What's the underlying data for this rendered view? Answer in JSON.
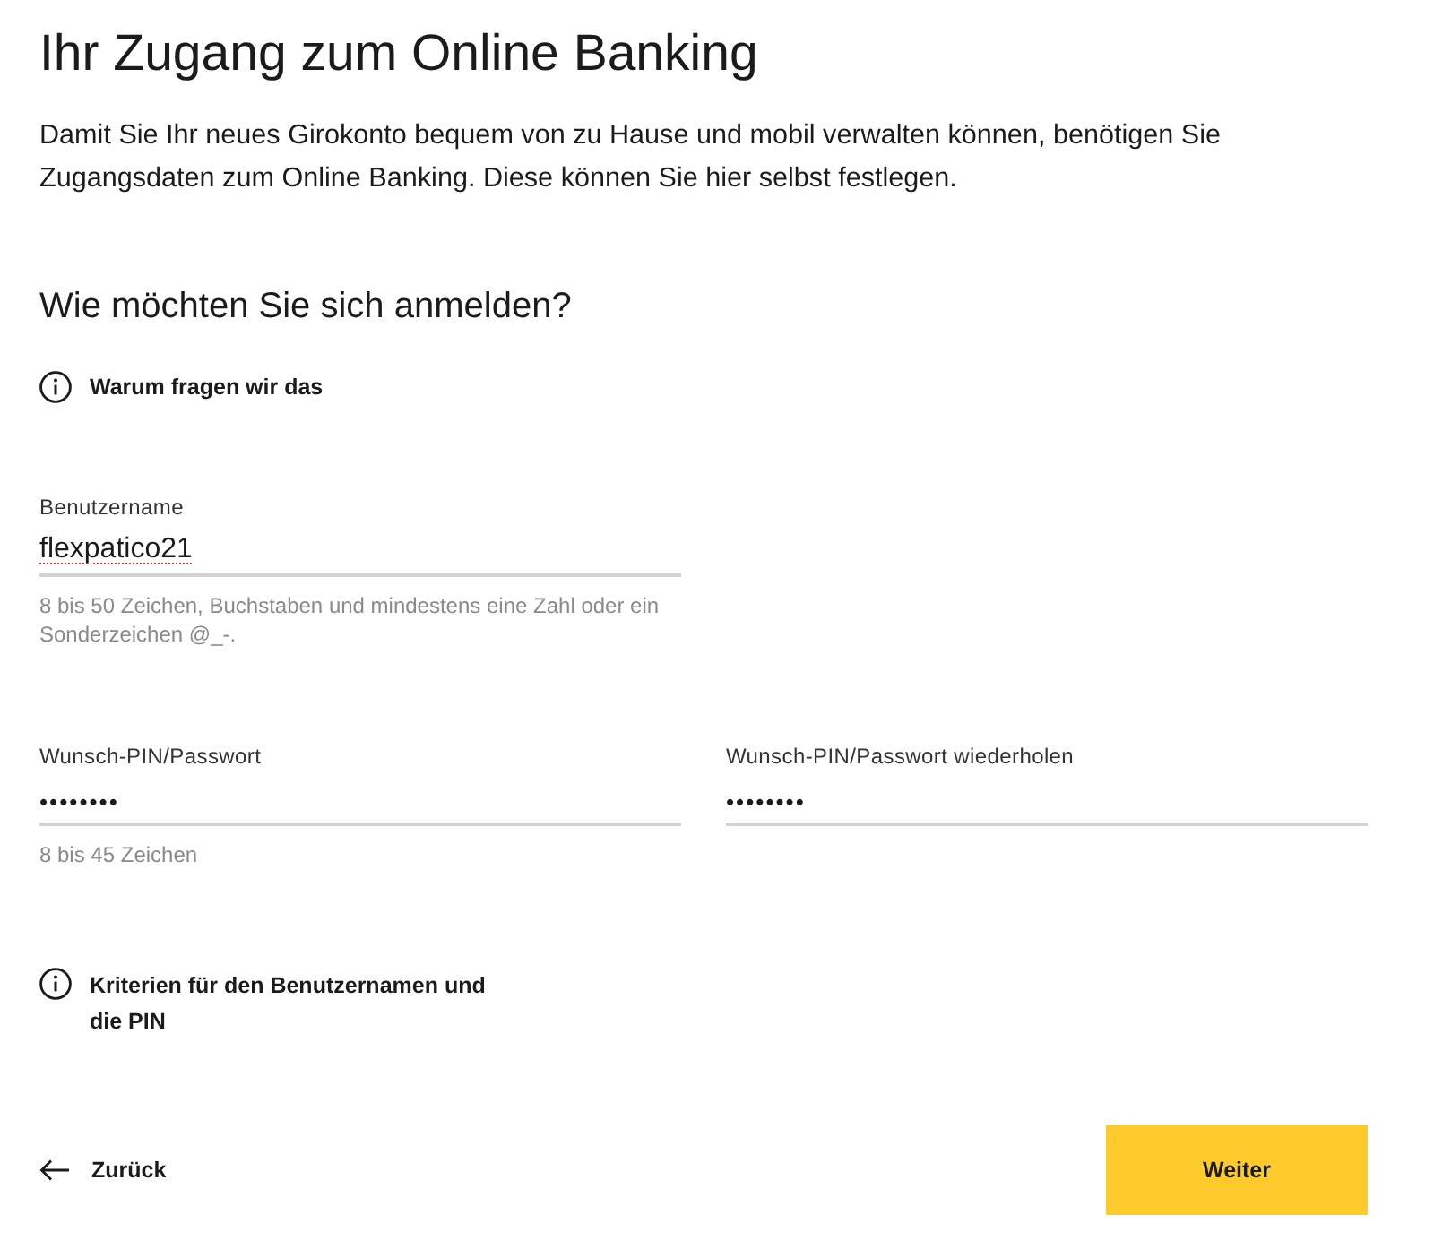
{
  "page": {
    "title": "Ihr Zugang zum Online Banking",
    "intro": "Damit Sie Ihr neues Girokonto bequem von zu Hause und mobil verwalten können, benötigen Sie Zugangsdaten zum Online Banking. Diese können Sie hier selbst festlegen."
  },
  "login": {
    "heading": "Wie möchten Sie sich anmelden?",
    "info_link": "Warum fragen wir das"
  },
  "rows": [
    {
      "fields": [
        {
          "kind": "text",
          "label": "Benutzername",
          "value": "flexpatico21",
          "misspelled": true,
          "hint": "8 bis 50 Zeichen, Buchstaben und mindestens eine Zahl oder ein Sonderzeichen @_-."
        }
      ]
    },
    {
      "fields": [
        {
          "kind": "password",
          "label": "Wunsch-PIN/Passwort",
          "value": "••••••••",
          "hint": "8 bis 45 Zeichen"
        },
        {
          "kind": "password",
          "label": "Wunsch-PIN/Passwort wiederholen",
          "value": "••••••••"
        }
      ]
    }
  ],
  "criteria_link": "Kriterien für den Benutzernamen und die PIN",
  "navigation": {
    "back": "Zurück",
    "next": "Weiter"
  }
}
